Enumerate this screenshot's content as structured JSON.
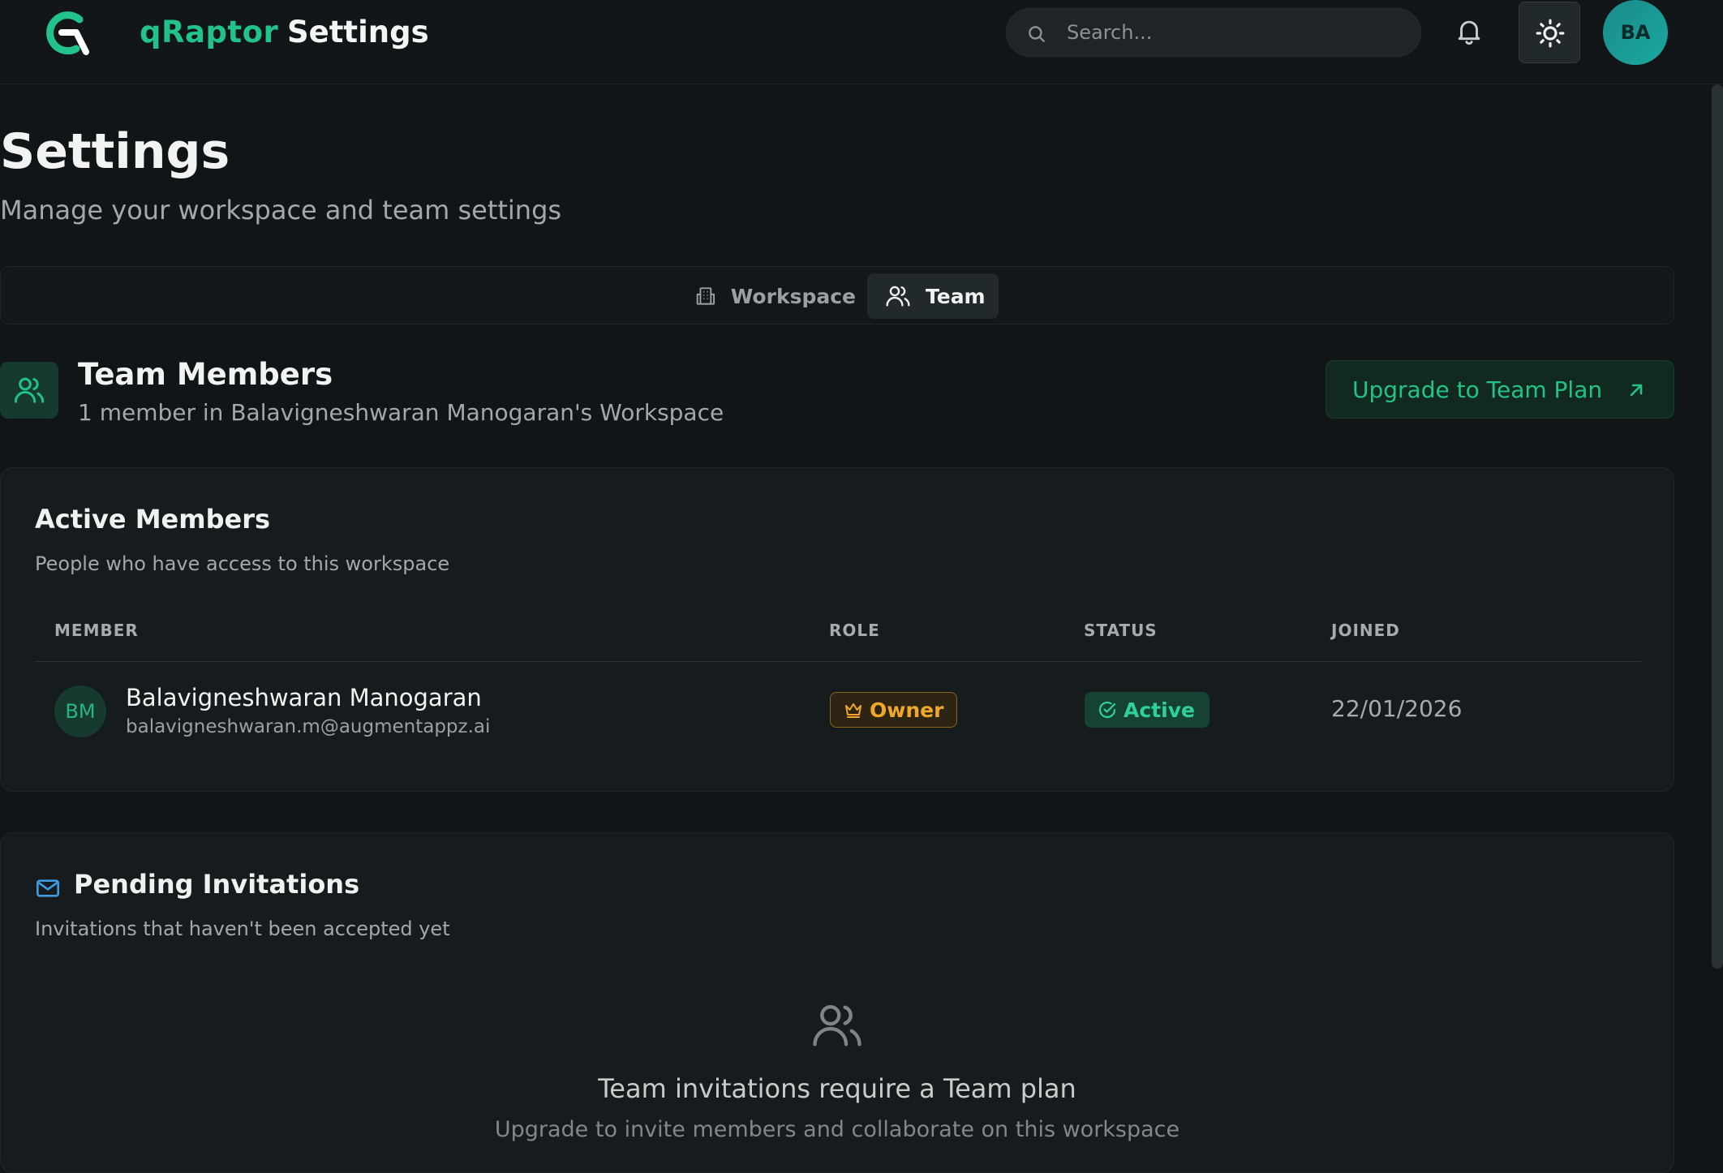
{
  "header": {
    "brand": "qRaptor",
    "section_title": "Settings",
    "search_placeholder": "Search...",
    "user_initials": "BA"
  },
  "page": {
    "title": "Settings",
    "subtitle": "Manage your workspace and team settings"
  },
  "tabs": [
    {
      "label": "Workspace",
      "icon": "building-icon",
      "active": false
    },
    {
      "label": "Team",
      "icon": "users-icon",
      "active": true
    }
  ],
  "team": {
    "title": "Team Members",
    "subtitle": "1 member in Balavigneshwaran Manogaran's Workspace",
    "upgrade_label": "Upgrade to Team Plan"
  },
  "active_members": {
    "title": "Active Members",
    "subtitle": "People who have access to this workspace",
    "columns": [
      "MEMBER",
      "ROLE",
      "STATUS",
      "JOINED"
    ],
    "rows": [
      {
        "initials": "BM",
        "name": "Balavigneshwaran Manogaran",
        "email": "balavigneshwaran.m@augmentappz.ai",
        "role": "Owner",
        "status": "Active",
        "joined": "22/01/2026"
      }
    ]
  },
  "pending": {
    "title": "Pending Invitations",
    "subtitle": "Invitations that haven't been accepted yet",
    "empty_title": "Team invitations require a Team plan",
    "empty_subtitle": "Upgrade to invite members and collaborate on this workspace"
  },
  "colors": {
    "accent": "#22c28c",
    "background": "#111517",
    "card": "#161b1d",
    "owner_badge": "#f0a82b",
    "active_badge": "#2fd19b",
    "mail_icon": "#3d9be0"
  }
}
